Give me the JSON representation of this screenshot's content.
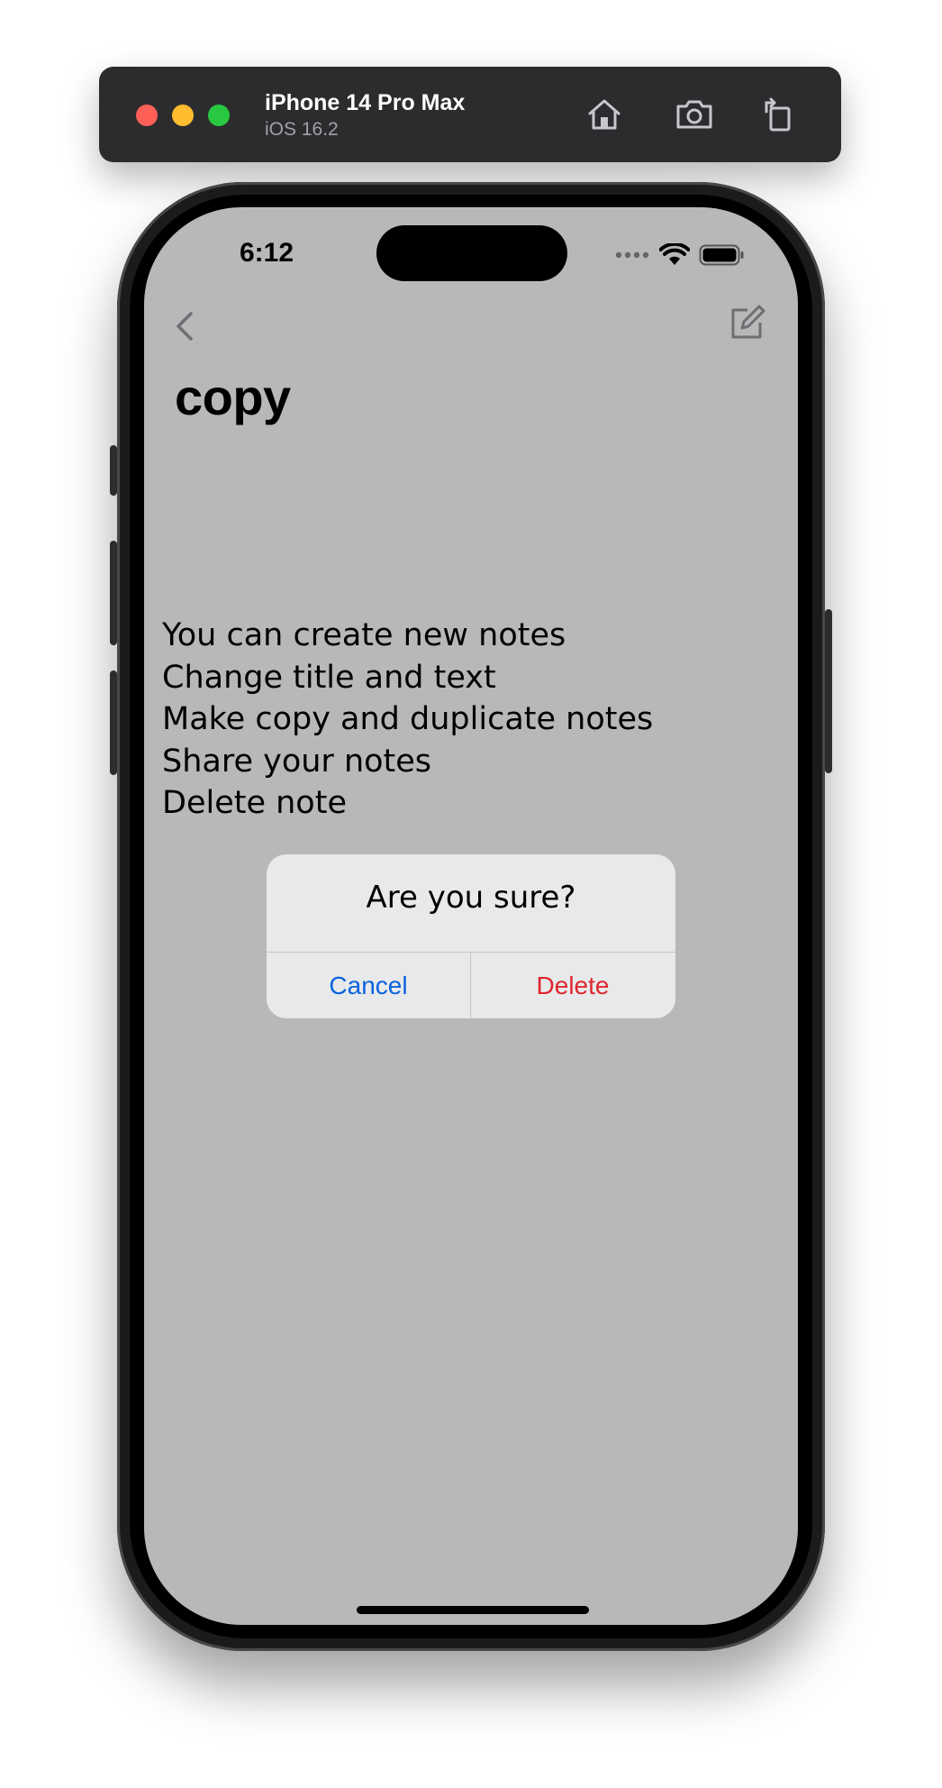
{
  "simulator": {
    "device_name": "iPhone 14 Pro Max",
    "os_version": "iOS 16.2"
  },
  "status_bar": {
    "time": "6:12"
  },
  "note": {
    "title": "copy",
    "lines": [
      "You can create new notes",
      "Change title and text",
      "Make copy and duplicate notes",
      "Share your notes",
      "Delete note"
    ]
  },
  "alert": {
    "title": "Are you sure?",
    "cancel_label": "Cancel",
    "delete_label": "Delete"
  },
  "colors": {
    "screen_background": "#b7b8b8",
    "alert_background": "#e8e9ea",
    "cancel_color": "#0a63e0",
    "delete_color": "#e0262e"
  }
}
